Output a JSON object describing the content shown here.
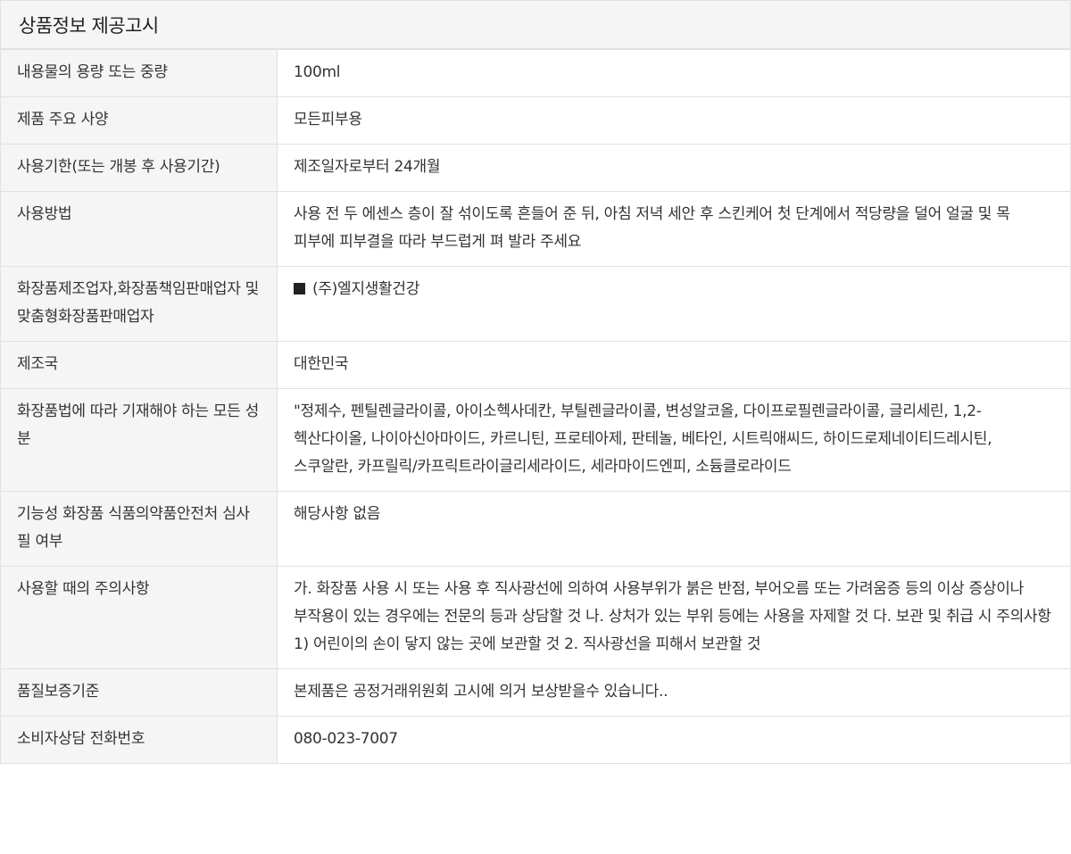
{
  "title": "상품정보 제공고시",
  "rows": [
    {
      "label": "내용물의 용량 또는 중량",
      "value": "100ml"
    },
    {
      "label": "제품 주요 사양",
      "value": "모든피부용"
    },
    {
      "label": "사용기한(또는 개봉 후 사용기간)",
      "value": "제조일자로부터 24개월"
    },
    {
      "label": "사용방법",
      "value": "사용 전 두 에센스 층이 잘 섞이도록 흔들어 준 뒤, 아침 저녁 세안 후 스킨케어 첫 단계에서 적당량을 덜어 얼굴 및 목 피부에 피부결을 따라 부드럽게 펴 발라 주세요"
    },
    {
      "label": "화장품제조업자,화장품책임판매업자 및 맞춤형화장품판매업자",
      "value": "(주)엘지생활건강",
      "bullet_icon": "black-square-icon"
    },
    {
      "label": "제조국",
      "value": "대한민국"
    },
    {
      "label": "화장품법에 따라 기재해야 하는 모든 성분",
      "value": "\"정제수, 펜틸렌글라이콜, 아이소헥사데칸, 부틸렌글라이콜, 변성알코올, 다이프로필렌글라이콜, 글리세린, 1,2-헥산다이올, 나이아신아마이드, 카르니틴, 프로테아제, 판테놀, 베타인, 시트릭애씨드, 하이드로제네이티드레시틴, 스쿠알란, 카프릴릭/카프릭트라이글리세라이드, 세라마이드엔피, 소듐클로라이드"
    },
    {
      "label": "기능성 화장품 식품의약품안전처 심사필 여부",
      "value": "해당사항 없음"
    },
    {
      "label": "사용할 때의 주의사항",
      "value": "가. 화장품 사용 시 또는 사용 후 직사광선에 의하여 사용부위가 붉은 반점, 부어오름 또는 가려움증 등의 이상 증상이나 부작용이 있는 경우에는 전문의 등과 상담할 것 나. 상처가 있는 부위 등에는 사용을 자제할 것 다. 보관 및 취급 시 주의사항 1) 어린이의 손이 닿지 않는 곳에 보관할 것 2. 직사광선을 피해서 보관할 것"
    },
    {
      "label": "품질보증기준",
      "value": "본제품은 공정거래위원회 고시에 의거 보상받을수 있습니다.."
    },
    {
      "label": "소비자상담 전화번호",
      "value": "080-023-7007"
    }
  ]
}
